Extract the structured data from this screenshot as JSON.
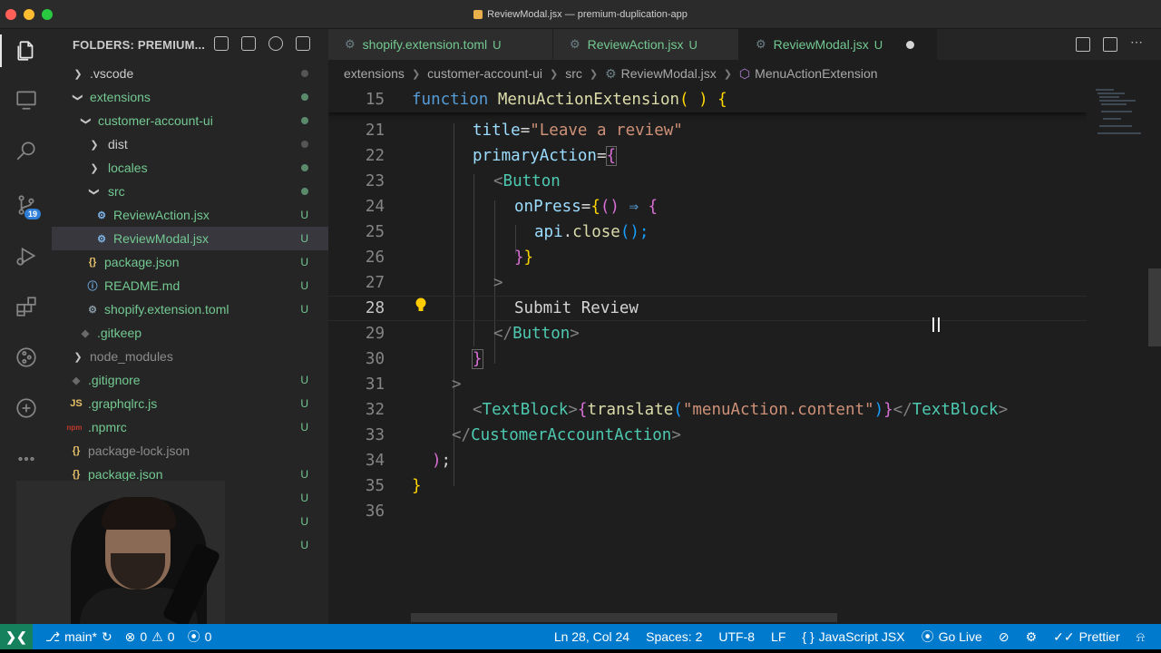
{
  "window": {
    "title": "ReviewModal.jsx — premium-duplication-app"
  },
  "activity_bar": {
    "source_control_badge": "19"
  },
  "sidebar": {
    "header": "FOLDERS: PREMIUM...",
    "items": [
      {
        "label": ".vscode",
        "status": ""
      },
      {
        "label": "extensions",
        "status": ""
      },
      {
        "label": "customer-account-ui",
        "status": ""
      },
      {
        "label": "dist",
        "status": ""
      },
      {
        "label": "locales",
        "status": ""
      },
      {
        "label": "src",
        "status": ""
      },
      {
        "label": "ReviewAction.jsx",
        "status": "U"
      },
      {
        "label": "ReviewModal.jsx",
        "status": "U"
      },
      {
        "label": "package.json",
        "status": "U",
        "icon": "{}"
      },
      {
        "label": "README.md",
        "status": "U"
      },
      {
        "label": "shopify.extension.toml",
        "status": "U"
      },
      {
        "label": ".gitkeep",
        "status": ""
      },
      {
        "label": "node_modules",
        "status": ""
      },
      {
        "label": ".gitignore",
        "status": "U"
      },
      {
        "label": ".graphqlrc.js",
        "status": "U",
        "icon": "JS"
      },
      {
        "label": ".npmrc",
        "status": "U",
        "icon": "npm"
      },
      {
        "label": "package-lock.json",
        "status": "",
        "icon": "{}"
      },
      {
        "label": "package.json",
        "status": "U",
        "icon": "{}"
      },
      {
        "label": "",
        "status": "U"
      },
      {
        "label": "",
        "status": "U"
      },
      {
        "label": "",
        "status": "U"
      }
    ]
  },
  "tabs": [
    {
      "name": "shopify.extension.toml",
      "status": "U"
    },
    {
      "name": "ReviewAction.jsx",
      "status": "U"
    },
    {
      "name": "ReviewModal.jsx",
      "status": "U"
    }
  ],
  "breadcrumb": [
    "extensions",
    "customer-account-ui",
    "src",
    "ReviewModal.jsx",
    "MenuActionExtension"
  ],
  "editor": {
    "line_numbers": [
      "15",
      "21",
      "22",
      "23",
      "24",
      "25",
      "26",
      "27",
      "28",
      "29",
      "30",
      "31",
      "32",
      "33",
      "34",
      "35",
      "36"
    ],
    "sticky": {
      "kw": "function",
      "name": "MenuActionExtension",
      "rest": "( ) {"
    },
    "l21": {
      "attr": "title",
      "eq": "=",
      "val": "\"Leave a review\""
    },
    "l22": {
      "attr": "primaryAction",
      "eq": "=",
      "brace": "{"
    },
    "l23": {
      "open": "<",
      "tag": "Button"
    },
    "l24": {
      "attr": "onPress",
      "eq": "=",
      "brace": "{",
      "args": "()",
      "arrow": " ⇒ ",
      "body": "{"
    },
    "l25": {
      "obj": "api",
      "dot": ".",
      "fn": "close",
      "rest": "();"
    },
    "l26": {
      "close": "}",
      "close2": "}"
    },
    "l27": {
      "gt": ">"
    },
    "l28": {
      "text": "Submit Review"
    },
    "l29": {
      "open": "</",
      "tag": "Button",
      "close": ">"
    },
    "l30": {
      "brace": "}"
    },
    "l31": {
      "gt": ">"
    },
    "l32": {
      "open": "<",
      "tag": "TextBlock",
      "gt": ">",
      "brace": "{",
      "fn": "translate",
      "paren": "(",
      "str": "\"menuAction.content\"",
      "cparen": ")",
      "cbrace": "}",
      "copen": "</",
      "ctag": "TextBlock",
      "cgt": ">"
    },
    "l33": {
      "open": "</",
      "tag": "CustomerAccountAction",
      "gt": ">"
    },
    "l34": {
      "paren": ")",
      "semi": ";"
    },
    "l35": {
      "brace": "}"
    }
  },
  "status_bar": {
    "branch": "main*",
    "errors": "0",
    "warnings": "0",
    "ports": "0",
    "position": "Ln 28, Col 24",
    "spaces": "Spaces: 2",
    "encoding": "UTF-8",
    "eol": "LF",
    "language": "JavaScript JSX",
    "golive": "Go Live",
    "prettier": "Prettier"
  }
}
